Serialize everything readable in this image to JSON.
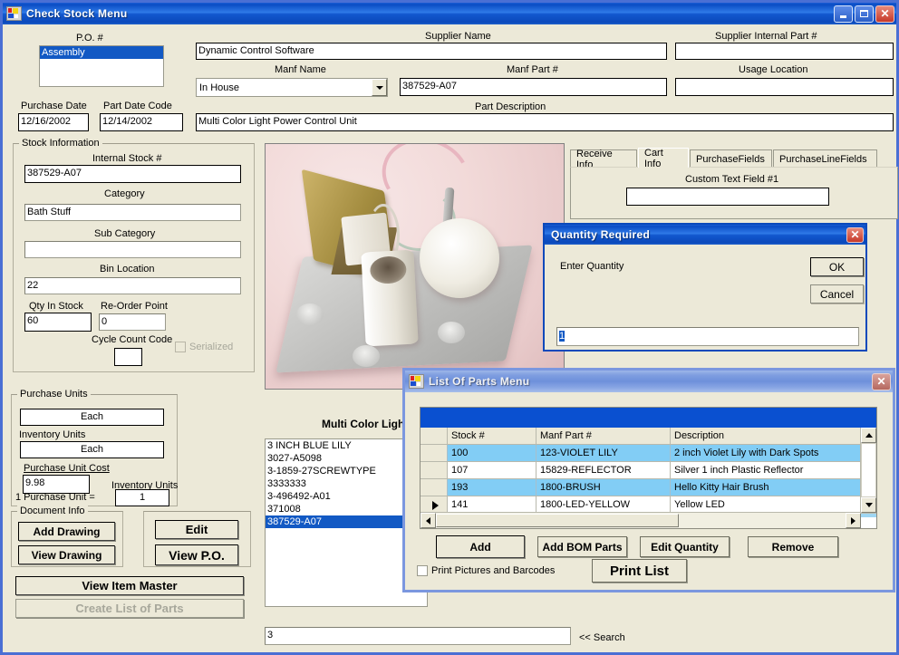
{
  "window": {
    "title": "Check Stock Menu",
    "buttons": {
      "minimize": "minimize-icon",
      "maximize": "maximize-icon",
      "close": "close-icon"
    }
  },
  "po": {
    "label": "P.O. #",
    "items": [
      "Assembly"
    ],
    "selected": "Assembly"
  },
  "dates": {
    "purchase_date_label": "Purchase Date",
    "purchase_date_value": "12/16/2002",
    "part_date_code_label": "Part Date Code",
    "part_date_code_value": "12/14/2002"
  },
  "header_fields": {
    "supplier_name_label": "Supplier Name",
    "supplier_name_value": "Dynamic Control Software",
    "supplier_internal_part_label": "Supplier Internal Part #",
    "supplier_internal_part_value": "",
    "manf_name_label": "Manf Name",
    "manf_name_value": "In House",
    "manf_part_label": "Manf Part #",
    "manf_part_value": "387529-A07",
    "usage_location_label": "Usage Location",
    "usage_location_value": "",
    "part_description_label": "Part Description",
    "part_description_value": "Multi Color Light Power Control Unit"
  },
  "stock_information": {
    "caption": "Stock Information",
    "internal_stock_label": "Internal Stock #",
    "internal_stock_value": "387529-A07",
    "category_label": "Category",
    "category_value": "Bath Stuff",
    "sub_category_label": "Sub Category",
    "sub_category_value": "",
    "bin_location_label": "Bin Location",
    "bin_location_value": "22",
    "qty_in_stock_label": "Qty In Stock",
    "qty_in_stock_value": "60",
    "reorder_point_label": "Re-Order Point",
    "reorder_point_value": "0",
    "cycle_count_code_label": "Cycle Count Code",
    "cycle_count_code_value": "",
    "serialized_label": "Serialized"
  },
  "purchase_units": {
    "caption": "Purchase Units",
    "purchase_units_value": "Each",
    "inventory_units_label": "Inventory Units",
    "inventory_units_value": "Each",
    "purchase_unit_cost_label": "Purchase Unit Cost",
    "purchase_unit_cost_value": "9.98",
    "inventory_units_2_label": "Inventory Units",
    "conversion_label": "1 Purchase Unit =",
    "conversion_value": "1"
  },
  "document_info": {
    "caption": "Document Info",
    "add_drawing": "Add Drawing",
    "view_drawing": "View Drawing",
    "edit": "Edit",
    "view_po": "View P.O.",
    "view_item_master": "View Item Master",
    "create_list_of_parts": "Create List of Parts"
  },
  "part_list": {
    "title": "Multi Color Light",
    "items": [
      "3 INCH BLUE LILY",
      "3027-A5098",
      "3-1859-27SCREWTYPE",
      "3333333",
      "3-496492-A01",
      "371008",
      "387529-A07"
    ],
    "selected_index": 6
  },
  "tabs": {
    "items": [
      {
        "label": "Receive Info",
        "active": false
      },
      {
        "label": "Cart Info",
        "active": true
      },
      {
        "label": "PurchaseFields",
        "active": false
      },
      {
        "label": "PurchaseLineFields",
        "active": false
      }
    ],
    "custom_text_field_label": "Custom Text Field #1",
    "custom_text_field_value": ""
  },
  "search": {
    "value": "3",
    "label": "<< Search"
  },
  "quantity_dialog": {
    "title": "Quantity Required",
    "prompt": "Enter Quantity",
    "ok": "OK",
    "cancel": "Cancel",
    "value": "1"
  },
  "list_of_parts": {
    "title": "List Of Parts Menu",
    "columns": [
      "",
      "Stock #",
      "Manf Part #",
      "Description"
    ],
    "rows": [
      {
        "mark": "",
        "stock": "100",
        "manf": "123-VIOLET LILY",
        "desc": "2 inch Violet Lily with Dark Spots",
        "selected": true
      },
      {
        "mark": "",
        "stock": "107",
        "manf": "15829-REFLECTOR",
        "desc": "Silver 1 inch Plastic Reflector",
        "selected": false
      },
      {
        "mark": "",
        "stock": "193",
        "manf": "1800-BRUSH",
        "desc": "Hello Kitty Hair Brush",
        "selected": true
      },
      {
        "mark": "▶",
        "stock": "141",
        "manf": "1800-LED-YELLOW",
        "desc": "Yellow LED",
        "selected": false
      }
    ],
    "buttons": {
      "add": "Add",
      "add_bom_parts": "Add BOM Parts",
      "edit_quantity": "Edit Quantity",
      "remove": "Remove",
      "print_list": "Print List"
    },
    "print_pictures_label": "Print Pictures and Barcodes"
  },
  "colors": {
    "face": "#ece9d8",
    "active_title": "#0a4cc4",
    "inactive_title": "#7e9de0",
    "selection": "#1259c4",
    "grid_selection": "#82cdf5",
    "grid_header_bar": "#0a50d0"
  }
}
